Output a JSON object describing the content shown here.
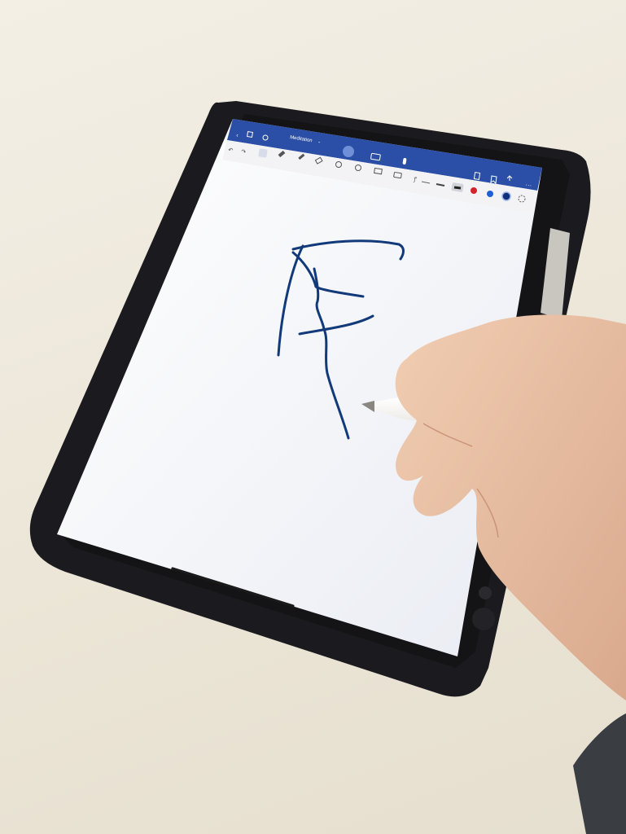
{
  "photo": {
    "subject": "",
    "colors": {
      "desk": "#ece6d8",
      "case": "#1b1b1f",
      "toolbar_blue": "#2b4fa6",
      "ribbon": "#f3f3f5",
      "canvas": "#f7f8fb",
      "ink": "#123a7a",
      "pencil": "#f4f2ee",
      "skin": "#e9c2a6"
    }
  },
  "word_app": {
    "document_title": "Meditation",
    "title_chevron": "chevron-down-icon",
    "top_bar_icons": [
      "back-icon",
      "grid-icon",
      "search-icon",
      "draw-mode-icon",
      "keyboard-icon",
      "microphone-icon",
      "undo-icon",
      "redo-icon"
    ],
    "ribbon_tools": [
      "pen-icon",
      "highlighter-icon",
      "pencil-icon",
      "eraser-icon",
      "lasso-icon",
      "shape-icon",
      "ink-to-shape-icon",
      "image-icon",
      "ruler-icon",
      "touch-icon"
    ],
    "stroke_widths": [
      "thin",
      "medium",
      "thick"
    ],
    "ink_colors": [
      "#d9212b",
      "#1f5fd6",
      "#0f2f7a"
    ],
    "right_icons": [
      "file-icon",
      "bookmark-icon",
      "share-icon",
      "more-icon"
    ],
    "ink_strokes": [
      "upper-arc",
      "left-leg",
      "middle-bar",
      "lower-bar",
      "center-leg"
    ]
  }
}
